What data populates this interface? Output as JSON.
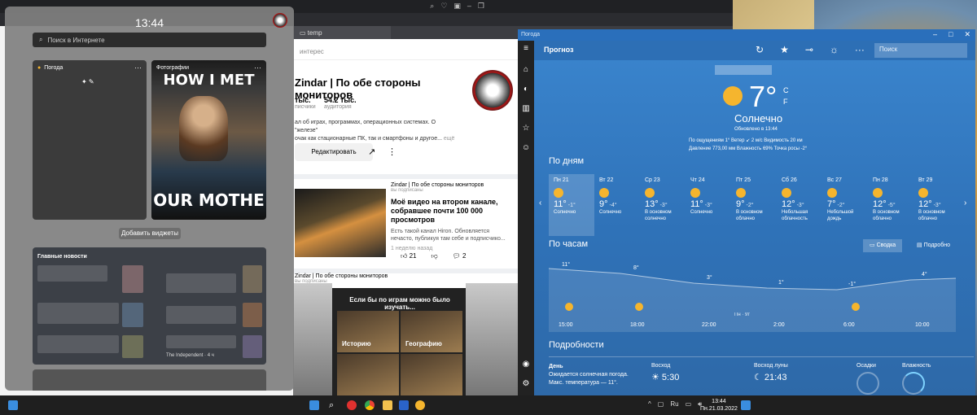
{
  "widgets": {
    "time": "13:44",
    "search_placeholder": "Поиск в Интернете",
    "weather_card_title": "Погода",
    "photos_card_title": "Фотографии",
    "photos_text_top": "HOW I MET",
    "photos_text_bottom": "OUR MOTHE",
    "add_widgets_label": "Добавить виджеты",
    "news_title": "Главные новости",
    "news_source": "The Independent · 4 ч"
  },
  "browser": {
    "tab_label": "temp",
    "zen": {
      "search_placeholder": "интерес",
      "channel_title": "Zindar | По обе стороны мониторов",
      "stat1_num": "тыс.",
      "stat1_lbl": "писчики",
      "stat2_num": "54.2 тыс.",
      "stat2_lbl": "аудитория",
      "desc1": "ал об играх, программах, операционных системах. О \"железе\"",
      "desc2": "очак как стационарные ПК, так и смартфоны и другое...",
      "desc_more": "ещё",
      "edit_label": "Редактировать",
      "card1_channel": "Zindar | По обе стороны мониторов",
      "card1_sub": "вы подписаны",
      "card1_title": "Моё видео на втором канале, собравшее почти 100 000 просмотров",
      "card1_text": "Есть такой канал Hiron. Обновляется нечасто, публикуя там себе и подписчико...",
      "card1_time": "1 неделю назад",
      "card1_likes": "21",
      "card1_comments": "2",
      "card2_channel": "Zindar | По обе стороны мониторов",
      "card2_sub": "вы подписаны",
      "card2_banner": "Если бы по играм можно было изучать...",
      "card2_thumb1": "Историю",
      "card2_thumb2": "Географию"
    }
  },
  "weather": {
    "window_title": "Погода",
    "header_title": "Прогноз",
    "search_placeholder": "Поиск",
    "temp": "7",
    "deg": "°",
    "unit_c": "C",
    "unit_f": "F",
    "condition": "Солнечно",
    "updated": "Обновлено в 13:44",
    "details_line1": "По ощущениям  1°    Ветер  ↙ 2 м/с    Видимость  20 км",
    "details_line2": "Давление  773,00 мм    Влажность  69%    Точка росы  -2°",
    "days_title": "По дням",
    "days": [
      {
        "d": "Пн 21",
        "t": "11°",
        "lo": "-1°",
        "c": "Солнечно"
      },
      {
        "d": "Вт 22",
        "t": "9°",
        "lo": "-4°",
        "c": "Солнечно"
      },
      {
        "d": "Ср 23",
        "t": "13°",
        "lo": "-3°",
        "c": "В основном солнечно"
      },
      {
        "d": "Чт 24",
        "t": "11°",
        "lo": "-3°",
        "c": "Солнечно"
      },
      {
        "d": "Пт 25",
        "t": "9°",
        "lo": "-2°",
        "c": "В основном облачно"
      },
      {
        "d": "Сб 26",
        "t": "12°",
        "lo": "-3°",
        "c": "Небольшая облачность"
      },
      {
        "d": "Вс 27",
        "t": "7°",
        "lo": "-2°",
        "c": "Небольшой дождь"
      },
      {
        "d": "Пн 28",
        "t": "12°",
        "lo": "-5°",
        "c": "В основном облачно"
      },
      {
        "d": "Вт 29",
        "t": "12°",
        "lo": "-3°",
        "c": "В основном облачно"
      }
    ],
    "hours_title": "По часам",
    "summary_label": "Сводка",
    "detailed_label": "Подробно",
    "hour_temps": [
      "11°",
      "8°",
      "3°",
      "1°",
      "-1°",
      "4°"
    ],
    "hour_times": [
      "15:00",
      "18:00",
      "22:00",
      "2:00",
      "6:00",
      "10:00"
    ],
    "hour_marker": "Пн · 9т",
    "details_title": "Подробности",
    "day_label": "День",
    "day_text1": "Ожидается солнечная погода.",
    "day_text2": "Макс. температура — 11°.",
    "sunrise_label": "Восход",
    "sunrise_value": "5:30",
    "moonrise_label": "Восход луны",
    "moonrise_value": "21:43",
    "precip_label": "Осадки",
    "humidity_label": "Влажность"
  },
  "taskbar": {
    "time": "13:44",
    "date": "Пн.21.03.2022"
  }
}
